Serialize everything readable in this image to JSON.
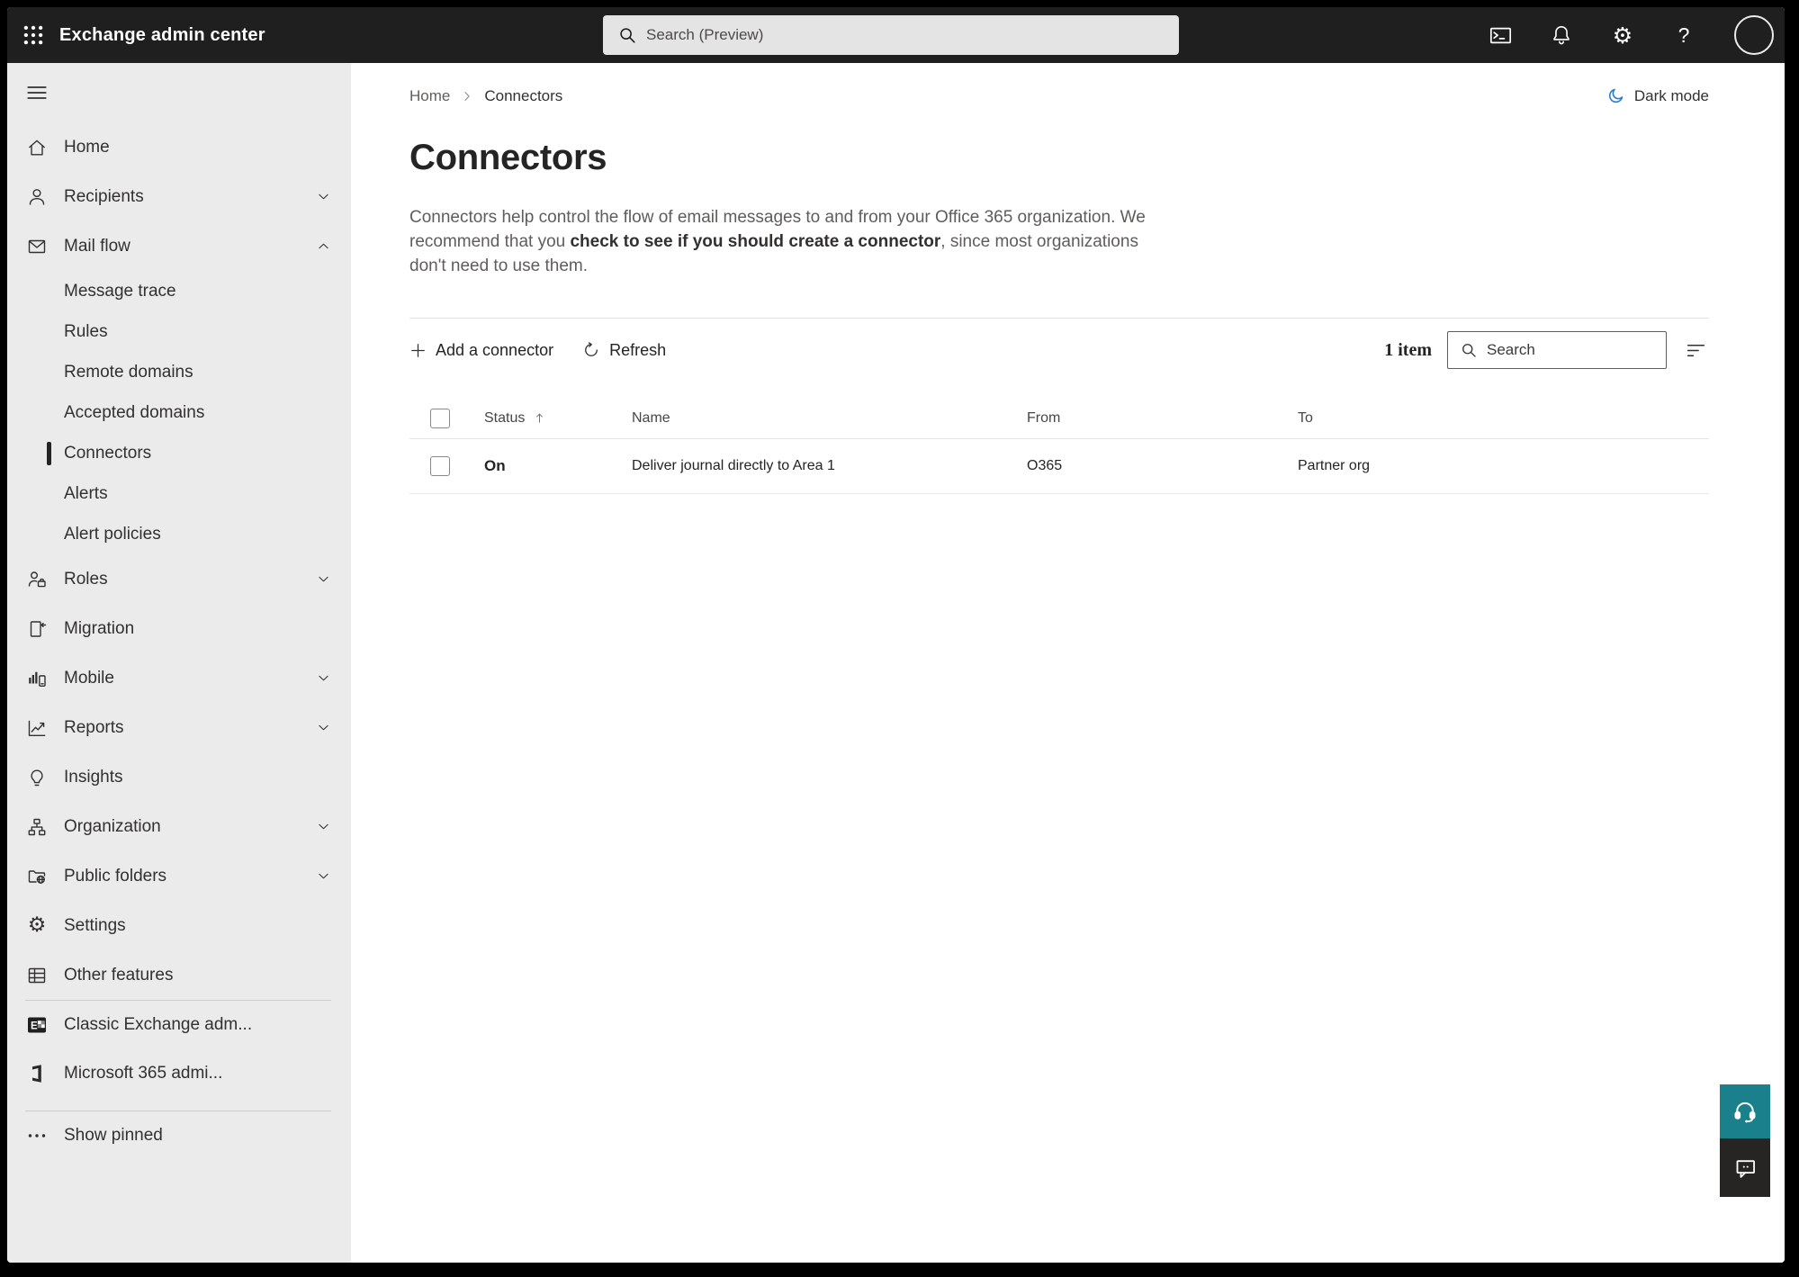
{
  "colors": {
    "topbar_bg": "#1f1f1f",
    "sidebar_bg": "#ebebeb",
    "accent_teal": "#1a808c",
    "dark_mode_icon_blue": "#2b7cd3",
    "selected_indicator": "#242424"
  },
  "topbar": {
    "title": "Exchange admin center",
    "search_placeholder": "Search (Preview)",
    "icons": [
      "app-launcher",
      "terminal",
      "bell",
      "gear",
      "help",
      "avatar"
    ]
  },
  "sidebar": {
    "items": [
      {
        "label": "Home",
        "icon": "home"
      },
      {
        "label": "Recipients",
        "icon": "person",
        "chevron": "down"
      },
      {
        "label": "Mail flow",
        "icon": "mail",
        "chevron": "up"
      },
      {
        "label": "Message trace",
        "sub": true
      },
      {
        "label": "Rules",
        "sub": true
      },
      {
        "label": "Remote domains",
        "sub": true
      },
      {
        "label": "Accepted domains",
        "sub": true
      },
      {
        "label": "Connectors",
        "sub": true,
        "selected": true
      },
      {
        "label": "Alerts",
        "sub": true
      },
      {
        "label": "Alert policies",
        "sub": true
      },
      {
        "label": "Roles",
        "icon": "person-briefcase",
        "chevron": "down"
      },
      {
        "label": "Migration",
        "icon": "document-arrow"
      },
      {
        "label": "Mobile",
        "icon": "chart-phone",
        "chevron": "down"
      },
      {
        "label": "Reports",
        "icon": "line-chart",
        "chevron": "down"
      },
      {
        "label": "Insights",
        "icon": "lightbulb"
      },
      {
        "label": "Organization",
        "icon": "org-chart",
        "chevron": "down"
      },
      {
        "label": "Public folders",
        "icon": "folder-globe",
        "chevron": "down"
      },
      {
        "label": "Settings",
        "icon": "gear"
      },
      {
        "label": "Other features",
        "icon": "grid-table"
      }
    ],
    "pinned": [
      {
        "label": "Classic Exchange adm...",
        "icon": "exchange-logo"
      },
      {
        "label": "Microsoft 365 admi...",
        "icon": "microsoft-365-logo"
      }
    ],
    "show_pinned": "Show pinned"
  },
  "main": {
    "breadcrumb": {
      "home": "Home",
      "current": "Connectors"
    },
    "dark_mode_label": "Dark mode",
    "title": "Connectors",
    "description": {
      "text_before": "Connectors help control the flow of email messages to and from your Office 365 organization. We recommend that you ",
      "link": "check to see if you should create a connector",
      "text_after": ", since most organizations don't need to use them."
    },
    "toolbar": {
      "add_connector": "Add a connector",
      "refresh": "Refresh",
      "item_count": "1 item",
      "search_placeholder": "Search"
    },
    "table": {
      "columns": {
        "status": "Status",
        "name": "Name",
        "from": "From",
        "to": "To"
      },
      "rows": [
        {
          "status": "On",
          "name": "Deliver journal directly to Area 1",
          "from": "O365",
          "to": "Partner org"
        }
      ]
    }
  }
}
